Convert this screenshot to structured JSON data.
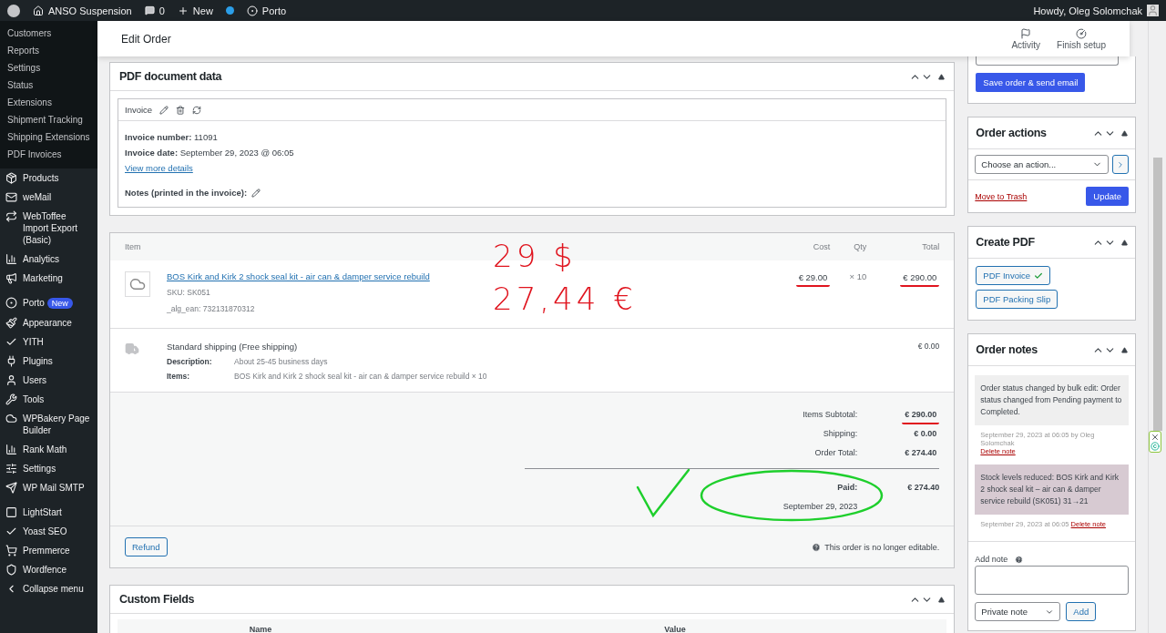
{
  "admin_bar": {
    "site": "ANSO Suspension",
    "comments": "0",
    "new": "New",
    "porto": "Porto",
    "greeting": "Howdy, Oleg Solomchak"
  },
  "sidebar": {
    "submenu": [
      "Customers",
      "Reports",
      "Settings",
      "Status",
      "Extensions",
      "Shipment Tracking",
      "Shipping Extensions",
      "PDF Invoices"
    ],
    "menu": [
      {
        "label": "Products"
      },
      {
        "label": "weMail"
      },
      {
        "label": "WebToffee Import Export (Basic)"
      },
      {
        "label": "Analytics"
      },
      {
        "label": "Marketing"
      },
      {
        "label": "Porto",
        "badge": "New"
      },
      {
        "label": "Appearance"
      },
      {
        "label": "YITH"
      },
      {
        "label": "Plugins"
      },
      {
        "label": "Users"
      },
      {
        "label": "Tools"
      },
      {
        "label": "WPBakery Page Builder"
      },
      {
        "label": "Rank Math"
      },
      {
        "label": "Settings"
      },
      {
        "label": "WP Mail SMTP"
      },
      {
        "label": "LightStart"
      },
      {
        "label": "Yoast SEO"
      },
      {
        "label": "Premmerce"
      },
      {
        "label": "Wordfence"
      },
      {
        "label": "Collapse menu"
      }
    ]
  },
  "header": {
    "title": "Edit Order",
    "actions": [
      {
        "label": "Activity"
      },
      {
        "label": "Finish setup"
      }
    ]
  },
  "pdf_panel": {
    "title": "PDF document data",
    "invoice_title": "Invoice",
    "fields": [
      {
        "label": "Invoice number:",
        "value": "11091"
      },
      {
        "label": "Invoice date:",
        "value": "September 29, 2023 @ 06:05"
      }
    ],
    "link": "View more details",
    "notes_label": "Notes (printed in the invoice):"
  },
  "items": {
    "columns": [
      "Item",
      "Cost",
      "Qty",
      "Total"
    ],
    "product": {
      "name": "BOS Kirk and Kirk 2 shock seal kit - air can & damper service rebuild",
      "sku_label": "SKU:",
      "sku": "SK051",
      "ean_label": "_alg_ean:",
      "ean": "732131870312",
      "cost": "€ 29.00",
      "qty_sign": "×",
      "qty": "10",
      "total": "€ 290.00"
    },
    "shipping": {
      "name": "Standard shipping (Free shipping)",
      "meta": [
        {
          "label": "Description:",
          "value": "About 25-45 business days"
        },
        {
          "label": "Items:",
          "value": "BOS Kirk and Kirk 2 shock seal kit - air can & damper service rebuild × 10"
        }
      ],
      "total": "€ 0.00"
    },
    "totals": [
      {
        "label": "Items Subtotal:",
        "value": "€ 290.00",
        "marked": true
      },
      {
        "label": "Shipping:",
        "value": "€ 0.00",
        "marked": false
      },
      {
        "label": "Order Total:",
        "value": "€ 274.40",
        "marked": false
      }
    ],
    "paid": {
      "label": "Paid:",
      "value": "€ 274.40",
      "date": "September 29, 2023"
    },
    "refund": "Refund",
    "notice": "This order is no longer editable.",
    "handwritten": [
      "29 $",
      "27,44 €"
    ]
  },
  "custom_fields": {
    "title": "Custom Fields",
    "columns": [
      "Name",
      "Value"
    ]
  },
  "save_button": "Save order & send email",
  "order_actions": {
    "title": "Order actions",
    "select": "Choose an action...",
    "trash": "Move to Trash",
    "update": "Update"
  },
  "create_pdf": {
    "title": "Create PDF",
    "buttons": [
      {
        "label": "PDF Invoice",
        "done": true
      },
      {
        "label": "PDF Packing Slip",
        "done": false
      }
    ]
  },
  "order_notes": {
    "title": "Order notes",
    "notes": [
      {
        "kind": "user",
        "text": "Order status changed by bulk edit: Order status changed from Pending payment to Completed.",
        "date": "September 29, 2023 at 06:05",
        "author": "by Oleg Solomchak",
        "delete": "Delete note"
      },
      {
        "kind": "system",
        "text": "Stock levels reduced: BOS Kirk and Kirk 2 shock seal kit – air can & damper service rebuild (SK051) 31→21",
        "date": "September 29, 2023 at 06:05",
        "delete": "Delete note"
      }
    ],
    "add_label": "Add note",
    "type": "Private note",
    "add": "Add"
  }
}
